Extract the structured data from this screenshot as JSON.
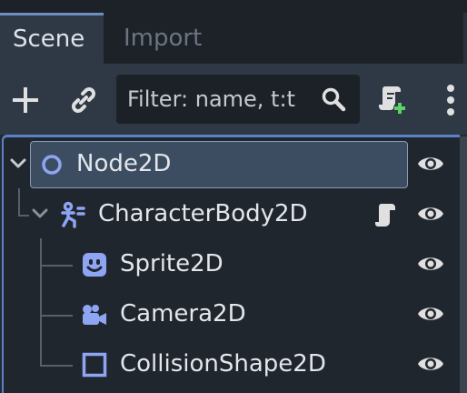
{
  "tabs": [
    {
      "label": "Scene",
      "active": true
    },
    {
      "label": "Import",
      "active": false
    }
  ],
  "toolbar": {
    "add_icon": "plus-icon",
    "link_icon": "link-icon",
    "filter_placeholder": "Filter: name, t:t",
    "search_icon": "magnifier-icon",
    "script_icon": "script-add-icon",
    "menu_icon": "vertical-dots-icon"
  },
  "tree": {
    "nodes": [
      {
        "name": "Node2D",
        "icon": "node2d-circle-icon",
        "selected": true,
        "expanded": true,
        "visible": true
      },
      {
        "name": "CharacterBody2D",
        "icon": "character-body-icon",
        "expanded": true,
        "has_script": true,
        "visible": true
      },
      {
        "name": "Sprite2D",
        "icon": "sprite-face-icon",
        "visible": true
      },
      {
        "name": "Camera2D",
        "icon": "camera-icon",
        "visible": true
      },
      {
        "name": "CollisionShape2D",
        "icon": "collision-square-icon",
        "visible": true
      }
    ]
  },
  "colors": {
    "accent": "#5a82c4",
    "node_2d_blue": "#8da5f3",
    "icon_gray": "#e0e0e0"
  }
}
